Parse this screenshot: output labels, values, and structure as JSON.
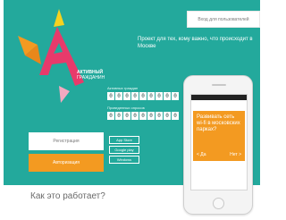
{
  "header": {
    "top_button_label": "Вход для пользователей"
  },
  "logo": {
    "brand_line_1": "АКТИВНЫЙ",
    "brand_line_2": "ГРАЖДАНИН"
  },
  "tagline": "Проект для тех, кому важно, что происходит в Москве",
  "counters": {
    "active_label": "Активных граждан",
    "active_digits": [
      "0",
      "0",
      "0",
      "0",
      "0",
      "0",
      "0",
      "0",
      "0"
    ],
    "poll_label": "Проведенных опросов",
    "poll_digits": [
      "0",
      "0",
      "0",
      "0",
      "0",
      "0",
      "0",
      "0",
      "0"
    ]
  },
  "stores": [
    "App Store",
    "Google play",
    "Windows"
  ],
  "buttons": {
    "login": "Регистрация",
    "register": "Авторизация"
  },
  "phone": {
    "question": "Развивать сеть wi-fi в московских парках?",
    "yes": "< Да",
    "no": "Нет >"
  },
  "how_it_works": "Как это работает?",
  "colors": {
    "teal": "#23a99c",
    "orange": "#f39a21"
  }
}
